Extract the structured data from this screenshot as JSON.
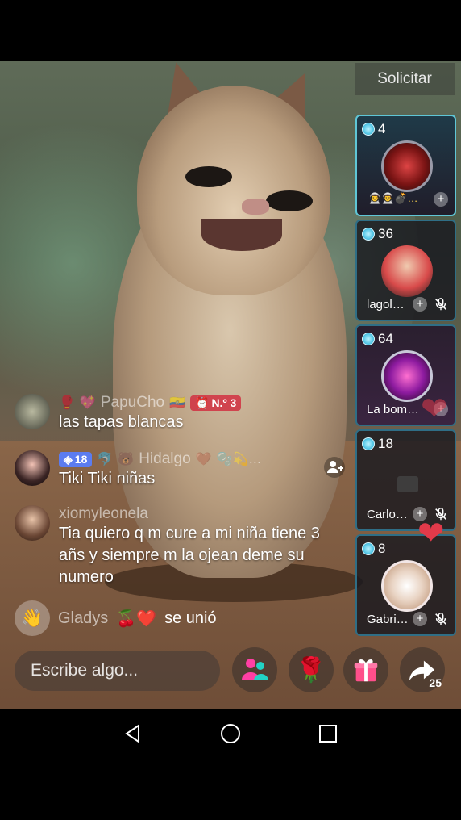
{
  "header": {
    "request_label": "Solicitar"
  },
  "guests": [
    {
      "score": "4",
      "name": "",
      "emoji_row": "👨‍🚀👨‍🚀💣…",
      "has_mic_off": false
    },
    {
      "score": "36",
      "name": "lagol…",
      "has_mic_off": true
    },
    {
      "score": "64",
      "name": "La bom…",
      "has_mic_off": false
    },
    {
      "score": "18",
      "name": "Carlo…",
      "has_mic_off": true
    },
    {
      "score": "8",
      "name": "Gabri…",
      "has_mic_off": true
    }
  ],
  "comments": [
    {
      "username": "PapuCho",
      "level_badge": "N.º 3",
      "text": "las tapas blancas"
    },
    {
      "username": "Hidalgo",
      "badge": "18",
      "text": "Tiki Tiki niñas"
    },
    {
      "username": "xiomyleonela",
      "text": "Tia quiero q m cure a mi niña tiene 3 añs y siempre m la ojean deme su numero"
    }
  ],
  "join": {
    "username": "Gladys",
    "emojis": "🍒❤️",
    "action": "se unió"
  },
  "bottom": {
    "input_placeholder": "Escribe algo...",
    "share_count": "25"
  },
  "colors": {
    "accent": "#5fc6d6",
    "heart": "#e23a4a",
    "gift": "#ff4f8b"
  }
}
